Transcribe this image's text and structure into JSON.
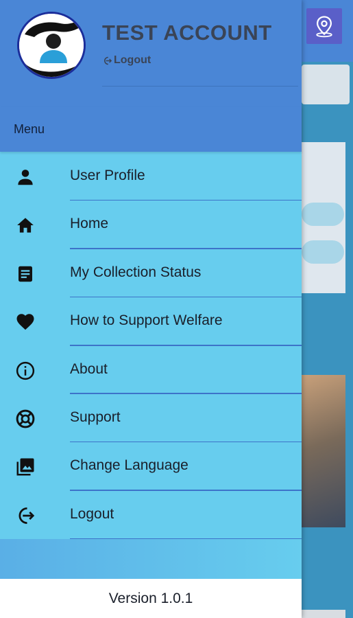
{
  "header": {
    "account_name": "TEST ACCOUNT",
    "logout_label": "Logout"
  },
  "menu": {
    "section_label": "Menu",
    "items": [
      {
        "label": "User Profile",
        "icon": "person-icon"
      },
      {
        "label": "Home",
        "icon": "home-icon"
      },
      {
        "label": "My Collection Status",
        "icon": "document-icon"
      },
      {
        "label": "How to Support Welfare",
        "icon": "heart-icon"
      },
      {
        "label": "About",
        "icon": "info-icon"
      },
      {
        "label": "Support",
        "icon": "lifebuoy-icon"
      },
      {
        "label": "Change Language",
        "icon": "image-stack-icon"
      },
      {
        "label": "Logout",
        "icon": "logout-icon"
      }
    ]
  },
  "footer": {
    "version": "Version 1.0.1"
  },
  "colors": {
    "drawer_bg": "#67cdee",
    "header_bg": "#4a86d6",
    "divider": "#3c73c9",
    "text": "#1a1f2a"
  }
}
